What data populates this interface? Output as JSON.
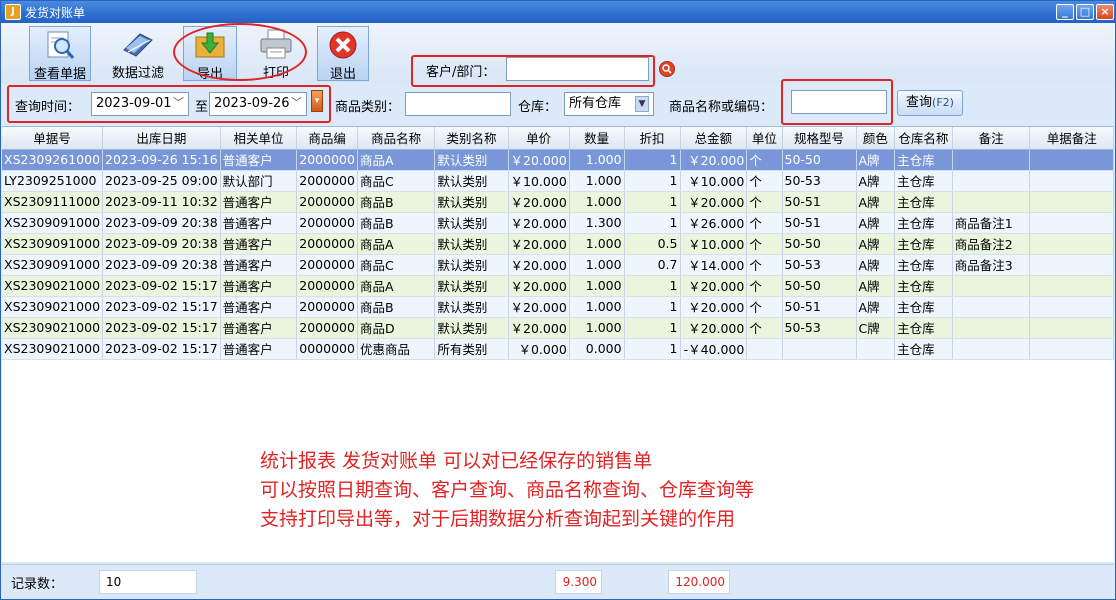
{
  "window": {
    "title": "发货对账单",
    "app_icon_glyph": "J",
    "controls": {
      "minimize": "_",
      "maximize": "□",
      "close": "×"
    }
  },
  "toolbar": {
    "view_label": "查看单据",
    "filter_label": "数据过滤",
    "export_label": "导出",
    "print_label": "打印",
    "exit_label": "退出"
  },
  "customer": {
    "label": "客户/部门：",
    "value": ""
  },
  "query": {
    "time_label": "查询时间：",
    "date_from": "2023-09-01",
    "to_label": "至",
    "date_to": "2023-09-26",
    "category_label": "商品类别：",
    "category_value": "",
    "warehouse_label": "仓库：",
    "warehouse_value": "所有仓库",
    "product_label": "商品名称或编码：",
    "product_value": "",
    "query_button": "查询",
    "query_shortcut": "(F2)"
  },
  "table": {
    "columns": [
      "单据号",
      "出库日期",
      "相关单位",
      "商品编",
      "商品名称",
      "类别名称",
      "单价",
      "数量",
      "折扣",
      "总金额",
      "单位",
      "规格型号",
      "颜色",
      "仓库名称",
      "备注",
      "单据备注"
    ],
    "rows": [
      [
        "XS2309261000",
        "2023-09-26 15:16",
        "普通客户",
        "2000000",
        "商品A",
        "默认类别",
        "￥20.000",
        "1.000",
        "1",
        "￥20.000",
        "个",
        "50-50",
        "A牌",
        "主仓库",
        "",
        ""
      ],
      [
        "LY2309251000",
        "2023-09-25 09:00",
        "默认部门",
        "2000000",
        "商品C",
        "默认类别",
        "￥10.000",
        "1.000",
        "1",
        "￥10.000",
        "个",
        "50-53",
        "A牌",
        "主仓库",
        "",
        ""
      ],
      [
        "XS2309111000",
        "2023-09-11 10:32",
        "普通客户",
        "2000000",
        "商品B",
        "默认类别",
        "￥20.000",
        "1.000",
        "1",
        "￥20.000",
        "个",
        "50-51",
        "A牌",
        "主仓库",
        "",
        ""
      ],
      [
        "XS2309091000",
        "2023-09-09 20:38",
        "普通客户",
        "2000000",
        "商品B",
        "默认类别",
        "￥20.000",
        "1.300",
        "1",
        "￥26.000",
        "个",
        "50-51",
        "A牌",
        "主仓库",
        "商品备注1",
        ""
      ],
      [
        "XS2309091000",
        "2023-09-09 20:38",
        "普通客户",
        "2000000",
        "商品A",
        "默认类别",
        "￥20.000",
        "1.000",
        "0.5",
        "￥10.000",
        "个",
        "50-50",
        "A牌",
        "主仓库",
        "商品备注2",
        ""
      ],
      [
        "XS2309091000",
        "2023-09-09 20:38",
        "普通客户",
        "2000000",
        "商品C",
        "默认类别",
        "￥20.000",
        "1.000",
        "0.7",
        "￥14.000",
        "个",
        "50-53",
        "A牌",
        "主仓库",
        "商品备注3",
        ""
      ],
      [
        "XS2309021000",
        "2023-09-02 15:17",
        "普通客户",
        "2000000",
        "商品A",
        "默认类别",
        "￥20.000",
        "1.000",
        "1",
        "￥20.000",
        "个",
        "50-50",
        "A牌",
        "主仓库",
        "",
        ""
      ],
      [
        "XS2309021000",
        "2023-09-02 15:17",
        "普通客户",
        "2000000",
        "商品B",
        "默认类别",
        "￥20.000",
        "1.000",
        "1",
        "￥20.000",
        "个",
        "50-51",
        "A牌",
        "主仓库",
        "",
        ""
      ],
      [
        "XS2309021000",
        "2023-09-02 15:17",
        "普通客户",
        "2000000",
        "商品D",
        "默认类别",
        "￥20.000",
        "1.000",
        "1",
        "￥20.000",
        "个",
        "50-53",
        "C牌",
        "主仓库",
        "",
        ""
      ],
      [
        "XS2309021000",
        "2023-09-02 15:17",
        "普通客户",
        "0000000",
        "优惠商品",
        "所有类别",
        "￥0.000",
        "0.000",
        "1",
        "-￥40.000",
        "",
        "",
        "",
        "主仓库",
        "",
        ""
      ]
    ]
  },
  "annotation": {
    "line1": "统计报表 发货对账单  可以对已经保存的销售单",
    "line2": "可以按照日期查询、客户查询、商品名称查询、仓库查询等",
    "line3": "支持打印导出等，对于后期数据分析查询起到关键的作用"
  },
  "status": {
    "record_label": "记录数：",
    "record_count": "10",
    "qty_total": "9.300",
    "amount_total": "120.000"
  },
  "colors": {
    "highlight": "#e12323",
    "selected_row": "#7996d8",
    "title_bar": "#2d6fcf"
  }
}
